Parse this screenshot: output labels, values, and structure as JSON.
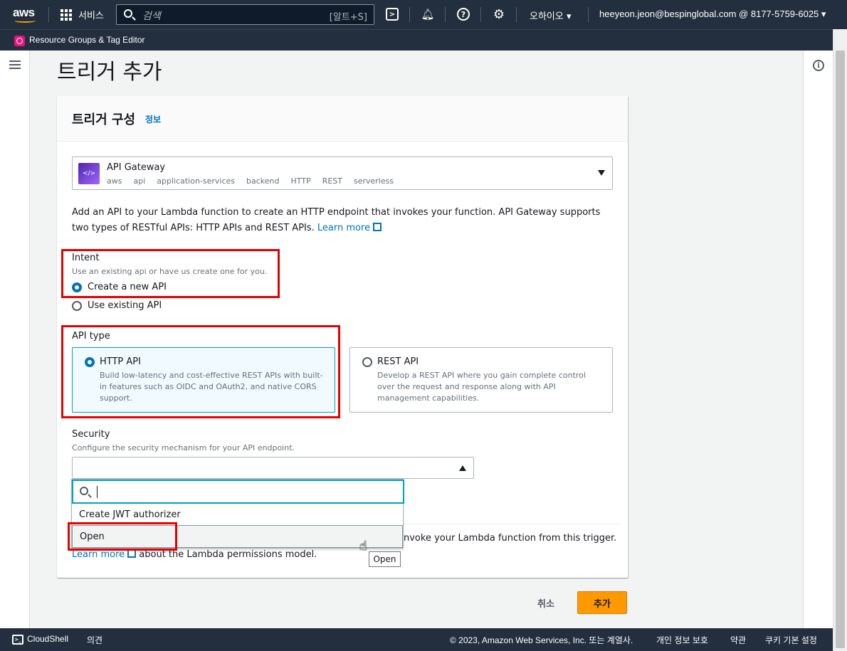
{
  "topnav": {
    "logo_text": "aws",
    "services_label": "서비스",
    "search_placeholder": "검색",
    "search_shortcut": "[알트+S]",
    "region_label": "오하이오 ▾",
    "account_label": "heeyeon.jeon@bespinglobal.com @ 8177-5759-6025 ▾"
  },
  "favbar": {
    "item_label": "Resource Groups & Tag Editor"
  },
  "page": {
    "title": "트리거 추가"
  },
  "card": {
    "title": "트리거 구성",
    "info_link": "정보",
    "trigger": {
      "name": "API Gateway",
      "icon_text": "</>",
      "tags": [
        "aws",
        "api",
        "application-services",
        "backend",
        "HTTP",
        "REST",
        "serverless"
      ]
    },
    "description": "Add an API to your Lambda function to create an HTTP endpoint that invokes your function. API Gateway supports two types of RESTful APIs: HTTP APIs and REST APIs.",
    "learn_more": "Learn more",
    "intent": {
      "label": "Intent",
      "description": "Use an existing api or have us create one for you.",
      "options": [
        {
          "label": "Create a new API",
          "selected": true
        },
        {
          "label": "Use existing API",
          "selected": false
        }
      ]
    },
    "api_type": {
      "label": "API type",
      "http": {
        "title": "HTTP API",
        "description": "Build low-latency and cost-effective REST APIs with built-in features such as OIDC and OAuth2, and native CORS support."
      },
      "rest": {
        "title": "REST API",
        "description": "Develop a REST API where you gain complete control over the request and response along with API management capabilities."
      }
    },
    "security": {
      "label": "Security",
      "description": "Configure the security mechanism for your API endpoint.",
      "value": "",
      "dropdown_options": [
        "Create JWT authorizer",
        "Open"
      ],
      "hovered_option": "Open",
      "tooltip": "Open"
    },
    "permissions_text_part1": "nvoke your Lambda function from this trigger.",
    "permissions_learn_more": "Learn more",
    "permissions_text_part2": "about the Lambda permissions model."
  },
  "actions": {
    "cancel": "취소",
    "add": "추가"
  },
  "bottombar": {
    "cloudshell": "CloudShell",
    "cloudshell_icon_text": ">_",
    "feedback": "의견",
    "copyright": "© 2023, Amazon Web Services, Inc. 또는 계열사.",
    "privacy": "개인 정보 보호",
    "terms": "약관",
    "cookies": "쿠키 기본 설정"
  },
  "colors": {
    "nav_bg": "#232f3e",
    "accent": "#ff9900",
    "link": "#0073bb",
    "highlight": "#e60000"
  },
  "icons": [
    "search-icon",
    "cloudshell-icon",
    "bell-icon",
    "help-icon",
    "gear-icon",
    "info-icon",
    "external-link-icon",
    "hamburger-icon"
  ]
}
